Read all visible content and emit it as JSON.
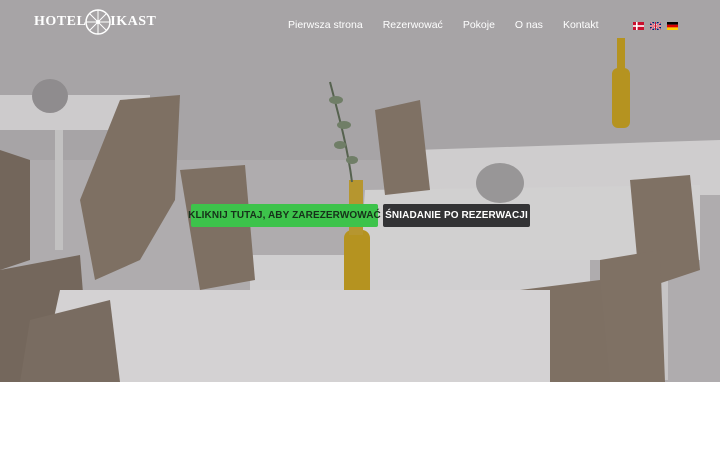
{
  "brand": {
    "logo_left": "HOTEL",
    "logo_right": "IKAST"
  },
  "nav": {
    "items": [
      {
        "label": "Pierwsza strona"
      },
      {
        "label": "Rezerwować"
      },
      {
        "label": "Pokoje"
      },
      {
        "label": "O nas"
      },
      {
        "label": "Kontakt"
      }
    ]
  },
  "languages": [
    {
      "icon": "danish-flag-icon",
      "colors": [
        "#c8102e",
        "#ffffff"
      ]
    },
    {
      "icon": "uk-flag-icon",
      "colors": [
        "#012169",
        "#ffffff",
        "#c8102e"
      ]
    },
    {
      "icon": "german-flag-icon",
      "colors": [
        "#000000",
        "#dd0000",
        "#ffce00"
      ]
    }
  ],
  "hero": {
    "book_button": "KLIKNIJ TUTAJ, ABY ZAREZERWOWAĆ",
    "breakfast_button": "ŚNIADANIE PO REZERWACJI"
  },
  "colors": {
    "accent_green": "#3dc34b",
    "dark_button": "#333335"
  }
}
